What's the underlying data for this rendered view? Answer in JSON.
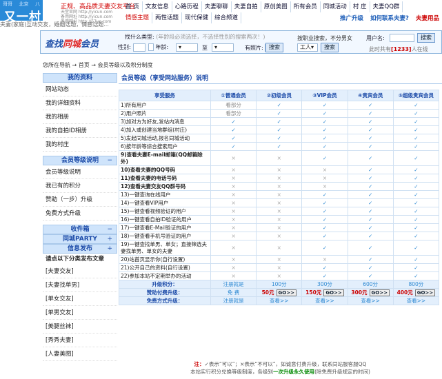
{
  "logo": {
    "top": [
      "哥哥",
      "北京",
      "八"
    ],
    "name": "又一村"
  },
  "header": {
    "slogan": "正规、高品质夫妻交友平台",
    "urls": [
      "天堂官网 http://yicun.com",
      "备用网址 http://yicun.com",
      "备用网址 http://57yc.com"
    ],
    "tagline": "夫妻(家庭)互动交友，婚姻话题，情感话题..."
  },
  "nav": {
    "row1": [
      "首 页",
      "文友信息",
      "心路历程",
      "夫妻聊聊",
      "夫妻自拍",
      "原创美图",
      "所有会员",
      "同城活动",
      "村 庄",
      "夫妻QQ群"
    ],
    "row2": [
      "情感主题",
      "两性话题",
      "现代保健",
      "综合频道"
    ],
    "links": [
      "推广升级",
      "如何联系夫妻?",
      "夫妻用品"
    ]
  },
  "search": {
    "title_a": "查找",
    "title_b": "同城",
    "title_c": "会员",
    "type_label": "找什么类型:",
    "type_hint": "(年龄段必须选择，不选择性别的搜索两次！)",
    "gender_label": "性别:",
    "age_label": "年龄:",
    "to_label": "至",
    "photo_label": "有照片:",
    "btn1": "搜索",
    "addr_label": "按职业搜索，不分男女",
    "job_value": "工人",
    "btn2": "搜索",
    "user_label": "用户名:",
    "btn3": "搜索",
    "online_prefix": "此时共有",
    "online_count": "[1233]",
    "online_suffix": "人在线"
  },
  "crumb": "您所在导航 → 首页 → 会员等级以及积分制度",
  "sidebar": {
    "s1": "我的资料",
    "items1": [
      "网站动态",
      "我的详细资料",
      "我的相册",
      "我的自拍ID相册",
      "我的村庄"
    ],
    "s2": "会员等级说明",
    "items2": [
      "会员等级说明",
      "我已有的积分",
      "赞助（一步）升级",
      "免费方式升级"
    ],
    "s3": "收件箱",
    "s4": "同城PARTY",
    "s5": "信息发布",
    "text": "请点以下分类发布文章",
    "items3": [
      "[夫妻交友]",
      "[夫妻找单男]",
      "[单女交友]",
      "[单男交友]",
      "[美腿丝袜]",
      "[秀秀夫妻]",
      "[人妻美图]"
    ]
  },
  "main": {
    "title": "会员等级（享受网站服务）说明",
    "headers": [
      "享受服务",
      "①普通会员",
      "②初级会员",
      "③VIP会员",
      "④贵宾会员",
      "⑤超级贵宾会员"
    ],
    "rows": [
      {
        "f": "1)所有用户",
        "v": [
          "看部分",
          "✓",
          "✓",
          "✓",
          "✓"
        ]
      },
      {
        "f": "2)用户照片",
        "v": [
          "看部分",
          "✓",
          "✓",
          "✓",
          "✓"
        ]
      },
      {
        "f": "3)加对方为好友,发站内消息",
        "v": [
          "✓",
          "✓",
          "✓",
          "✓",
          "✓"
        ]
      },
      {
        "f": "4)加入或创建当地群组(村庄)",
        "v": [
          "✓",
          "✓",
          "✓",
          "✓",
          "✓"
        ]
      },
      {
        "f": "5)发起同城活动,报名同城活动",
        "v": [
          "✓",
          "✓",
          "✓",
          "✓",
          "✓"
        ]
      },
      {
        "f": "6)按年龄等综合搜索用户",
        "v": [
          "✓",
          "✓",
          "✓",
          "✓",
          "✓"
        ]
      },
      {
        "f": "9)查看夫妻E-mail邮箱(QQ邮箱除外)",
        "v": [
          "×",
          "×",
          "✓",
          "✓",
          "✓"
        ],
        "b": true,
        "tall": true
      },
      {
        "f": "10)查看夫妻的QQ号码",
        "v": [
          "×",
          "×",
          "×",
          "✓",
          "✓"
        ],
        "b": true
      },
      {
        "f": "11)查看夫妻的电话号码",
        "v": [
          "×",
          "×",
          "×",
          "✓",
          "✓"
        ],
        "b": true
      },
      {
        "f": "12)查看夫妻交友QQ群号码",
        "v": [
          "×",
          "×",
          "×",
          "✓",
          "✓"
        ],
        "b": true
      },
      {
        "f": "13)一键查询在线用户",
        "v": [
          "×",
          "×",
          "✓",
          "✓",
          "✓"
        ]
      },
      {
        "f": "14)一键查看VIP用户",
        "v": [
          "×",
          "×",
          "✓",
          "✓",
          "✓"
        ]
      },
      {
        "f": "15)一键查看视频验证的用户",
        "v": [
          "×",
          "×",
          "✓",
          "✓",
          "✓"
        ]
      },
      {
        "f": "16)一键查看自拍ID验证的用户",
        "v": [
          "×",
          "×",
          "✓",
          "✓",
          "✓"
        ]
      },
      {
        "f": "17)一键查看E-Mail验证的用户",
        "v": [
          "×",
          "×",
          "✓",
          "✓",
          "✓"
        ]
      },
      {
        "f": "18)一键查看手机号验证的用户",
        "v": [
          "×",
          "×",
          "✓",
          "✓",
          "✓"
        ]
      },
      {
        "f": "19)一键查找单男、单女；直接筛选夫妻找单男、单女的夫妻",
        "v": [
          "×",
          "×",
          "✓",
          "✓",
          "✓"
        ],
        "tall": true
      },
      {
        "f": "20)站首页显示你(自行设置)",
        "v": [
          "×",
          "×",
          "×",
          "✓",
          "✓"
        ]
      },
      {
        "f": "21)公开自己的资料(自行设置)",
        "v": [
          "×",
          "×",
          "✓",
          "✓",
          "✓"
        ]
      },
      {
        "f": "22)参加本站不定期举办的活动",
        "v": [
          "×",
          "×",
          "✓",
          "✓",
          "✓"
        ]
      }
    ],
    "points": {
      "label": "升级积分：",
      "v": [
        "注册就是",
        "100分",
        "300分",
        "600分",
        "800分"
      ]
    },
    "sponsor": {
      "label": "赞助付费升级：",
      "v": [
        "免 费",
        "50元",
        "150元",
        "300元",
        "400元"
      ],
      "go": "GO>>"
    },
    "free": {
      "label": "免费方式升级：",
      "v": [
        "注册就是",
        "查看>>",
        "查看>>",
        "查看>>",
        "查看>>"
      ]
    }
  },
  "note": {
    "a": "注：",
    "b": "✓表示“可以”；×表示“不可以”，如诚意付费升级，联系同站服客服QQ",
    "c": "本站实行积分兑换等级制度，各级别",
    "d": "一次升级永久使用",
    "e": "(除免费升级规定的时间)"
  }
}
